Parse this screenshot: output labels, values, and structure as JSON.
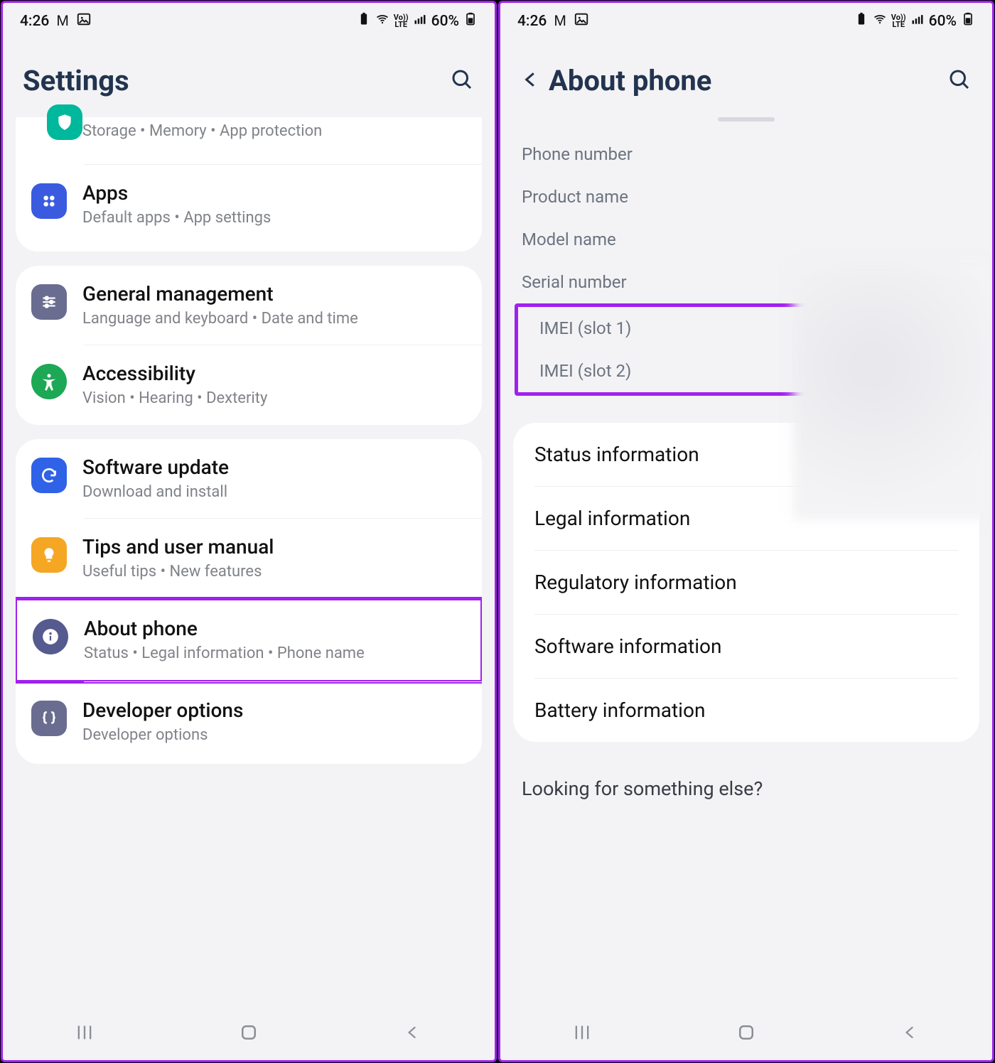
{
  "status": {
    "time": "4:26",
    "battery": "60%",
    "volte": "Vo))\nLTE"
  },
  "left": {
    "title": "Settings",
    "partial_sub": "Storage  •  Memory  •  App protection",
    "groups": [
      {
        "rows": [
          {
            "icon": "apps",
            "color": "#3a5be0",
            "title": "Apps",
            "sub": "Default apps  •  App settings"
          }
        ]
      },
      {
        "rows": [
          {
            "icon": "sliders",
            "color": "#6a6d8f",
            "title": "General management",
            "sub": "Language and keyboard  •  Date and time"
          },
          {
            "icon": "accessibility",
            "color": "#1da856",
            "title": "Accessibility",
            "sub": "Vision  •  Hearing  •  Dexterity"
          }
        ]
      },
      {
        "rows": [
          {
            "icon": "update",
            "color": "#2f62e6",
            "title": "Software update",
            "sub": "Download and install"
          },
          {
            "icon": "bulb",
            "color": "#f5a623",
            "title": "Tips and user manual",
            "sub": "Useful tips  •  New features"
          },
          {
            "icon": "info",
            "color": "#555a8f",
            "title": "About phone",
            "sub": "Status  •  Legal information  •  Phone name",
            "highlight": true
          },
          {
            "icon": "braces",
            "color": "#6a6d8f",
            "title": "Developer options",
            "sub": "Developer options"
          }
        ]
      }
    ]
  },
  "right": {
    "title": "About phone",
    "info": [
      "Phone number",
      "Product name",
      "Model name",
      "Serial number",
      "IMEI (slot 1)",
      "IMEI (slot 2)"
    ],
    "highlight_start": 4,
    "cards": [
      "Status information",
      "Legal information",
      "Regulatory information",
      "Software information",
      "Battery information"
    ],
    "footer": "Looking for something else?"
  }
}
